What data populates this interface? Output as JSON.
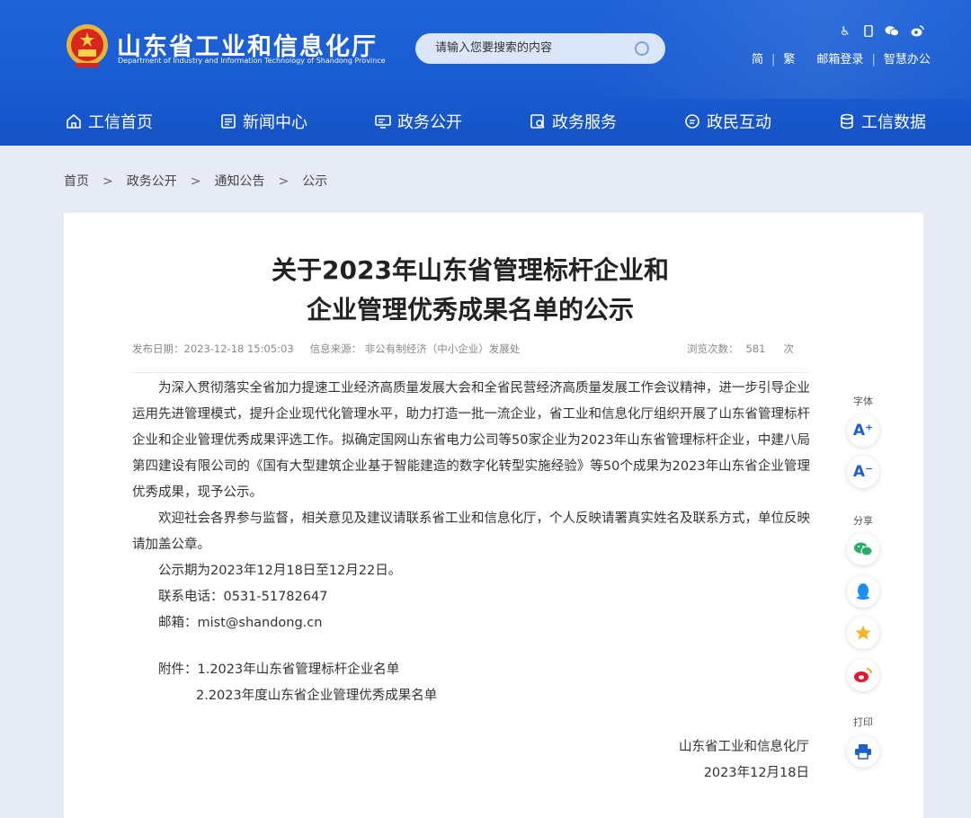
{
  "header": {
    "site_title": "山东省工业和信息化厅",
    "site_subtitle": "Department of Industry and Information Technology of Shandong Province",
    "search_placeholder": "请输入您要搜索的内容",
    "links": [
      "简",
      "繁",
      "邮箱登录",
      "智慧办公"
    ],
    "tool_icons": [
      "accessibility-icon",
      "mobile-icon",
      "wechat-icon",
      "weibo-icon"
    ]
  },
  "nav": [
    {
      "label": "工信首页",
      "icon": "home-icon"
    },
    {
      "label": "新闻中心",
      "icon": "news-icon"
    },
    {
      "label": "政务公开",
      "icon": "monitor-icon"
    },
    {
      "label": "政务服务",
      "icon": "service-icon"
    },
    {
      "label": "政民互动",
      "icon": "chat-icon"
    },
    {
      "label": "工信数据",
      "icon": "database-icon"
    }
  ],
  "breadcrumb": [
    "首页",
    "政务公开",
    "通知公告",
    "公示"
  ],
  "breadcrumb_sep": ">",
  "article": {
    "title_line1": "关于2023年山东省管理标杆企业和",
    "title_line2": "企业管理优秀成果名单的公示",
    "meta_date": "发布日期：2023-12-18 15:05:03",
    "meta_source": "信息来源：  非公有制经济（中小企业）发展处",
    "meta_views_label": "浏览次数：",
    "meta_views": "581",
    "meta_views_unit": "次",
    "para1": "为深入贯彻落实全省加力提速工业经济高质量发展大会和全省民营经济高质量发展工作会议精神，进一步引导企业运用先进管理模式，提升企业现代化管理水平，助力打造一批一流企业，省工业和信息化厅组织开展了山东省管理标杆企业和企业管理优秀成果评选工作。拟确定国网山东省电力公司等50家企业为2023年山东省管理标杆企业，中建八局第四建设有限公司的《国有大型建筑企业基于智能建造的数字化转型实施经验》等50个成果为2023年山东省企业管理优秀成果，现予公示。",
    "para2": "欢迎社会各界参与监督，相关意见及建议请联系省工业和信息化厅，个人反映请署真实姓名及联系方式，单位反映请加盖公章。",
    "period": "公示期为2023年12月18日至12月22日。",
    "phone": "联系电话：0531-51782647",
    "email": "邮箱：mist@shandong.cn",
    "attach1": "附件：1.2023年山东省管理标杆企业名单",
    "attach2": "2.2023年度山东省企业管理优秀成果名单",
    "signer": "山东省工业和信息化厅",
    "sign_date": "2023年12月18日"
  },
  "side": {
    "font_label": "字体",
    "font_plus": "A⁺",
    "font_minus": "A⁻",
    "share_label": "分享",
    "print_label": "打印"
  },
  "colors": {
    "header_blue": "#1a5cd2",
    "page_bg": "#e6ebf5"
  }
}
